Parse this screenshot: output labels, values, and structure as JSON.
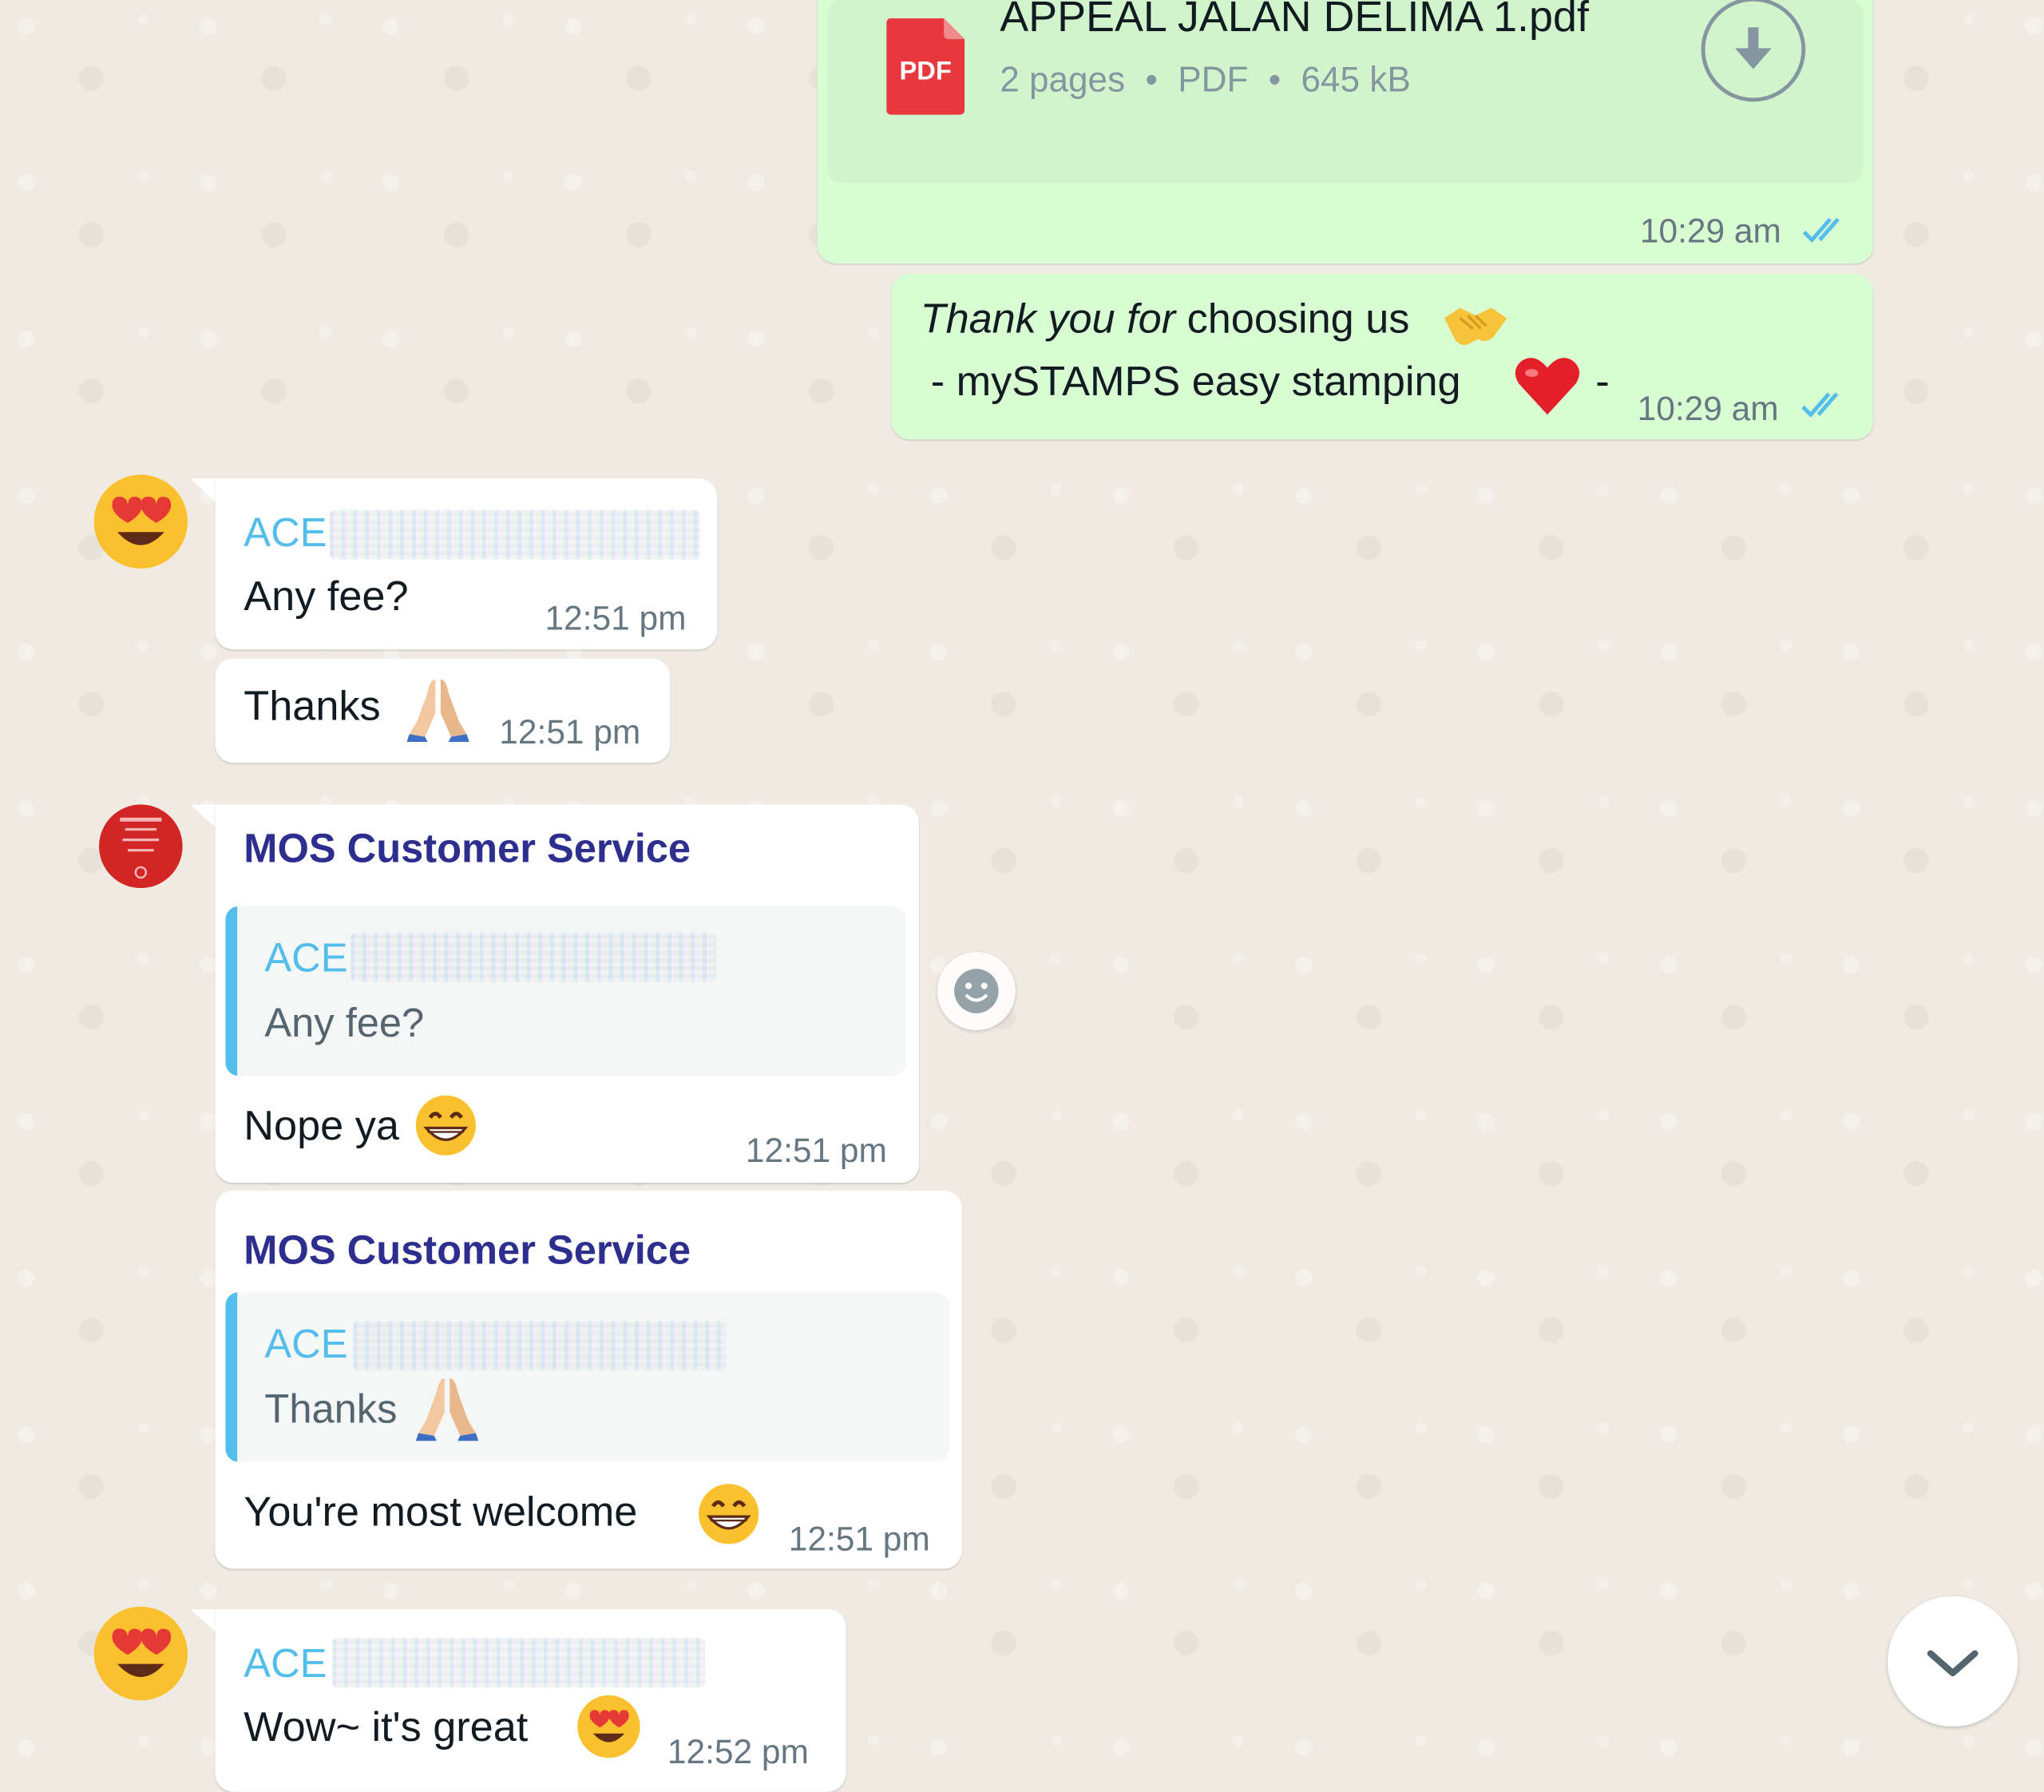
{
  "document_message": {
    "filename": "APPEAL JALAN DELIMA 1.pdf",
    "file_type_badge": "PDF",
    "pages": "2 pages",
    "type": "PDF",
    "size": "645 kB",
    "separator": "•",
    "time": "10:29 am"
  },
  "thankyou_message": {
    "italic_part": "Thank you for",
    "rest_line1": "choosing us",
    "line2_prefix": "- mySTAMPS easy stamping",
    "line2_suffix": "-",
    "time": "10:29 am"
  },
  "messages": [
    {
      "sender": "ACE",
      "text": "Any fee?",
      "time": "12:51 pm"
    },
    {
      "text": "Thanks",
      "time": "12:51 pm"
    },
    {
      "sender": "MOS Customer Service",
      "quote_sender": "ACE",
      "quote_text": "Any fee?",
      "text": "Nope ya",
      "time": "12:51 pm"
    },
    {
      "sender": "MOS Customer Service",
      "quote_sender": "ACE",
      "quote_text": "Thanks",
      "text": "You're most welcome",
      "time": "12:51 pm"
    },
    {
      "sender": "ACE",
      "text": "Wow~ it's great",
      "time": "12:52 pm"
    }
  ],
  "icons": {
    "download": "download-icon",
    "react": "emoji-react-icon",
    "scroll_down": "chevron-down-icon",
    "read_receipt": "double-check-icon"
  },
  "colors": {
    "outgoing_bubble": "#d9fdd3",
    "incoming_bubble": "#ffffff",
    "chat_background": "#efeae2",
    "ace_name": "#53bdeb",
    "mos_name": "#2e2e8f",
    "read_ticks": "#53bdeb",
    "pdf_badge": "#e8383d"
  }
}
